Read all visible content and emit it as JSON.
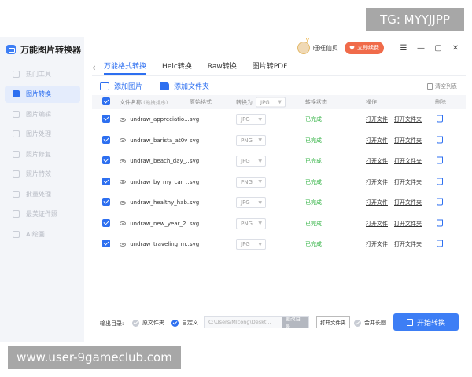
{
  "app": {
    "title": "万能图片转换器"
  },
  "sidebar": {
    "items": [
      {
        "label": "热门工具",
        "active": false
      },
      {
        "label": "图片转换",
        "active": true
      },
      {
        "label": "图片编辑",
        "active": false
      },
      {
        "label": "图片处理",
        "active": false
      },
      {
        "label": "照片修复",
        "active": false
      },
      {
        "label": "照片特效",
        "active": false
      },
      {
        "label": "批量处理",
        "active": false
      },
      {
        "label": "最美证件照",
        "active": false
      },
      {
        "label": "AI绘画",
        "active": false
      }
    ]
  },
  "topbar": {
    "user_name": "旺旺仙贝",
    "vip_label": "立即续费",
    "menu_icon": "menu-icon",
    "minimize": "—",
    "maximize": "▢",
    "close": "✕"
  },
  "tabs": [
    {
      "label": "万能格式转换",
      "active": true
    },
    {
      "label": "Heic转换",
      "active": false
    },
    {
      "label": "Raw转换",
      "active": false
    },
    {
      "label": "图片转PDF",
      "active": false
    }
  ],
  "toolbar": {
    "add_image": "添加图片",
    "add_folder": "添加文件夹",
    "clear_list": "清空列表"
  },
  "table": {
    "headers": {
      "file_name": "文件名称",
      "file_name_hint": "(拖拽排序)",
      "original_format": "原始格式",
      "convert_to": "转换为",
      "convert_to_value": "JPG",
      "status": "转换状态",
      "actions": "操作",
      "delete": "删除"
    },
    "rows": [
      {
        "name": "undraw_appreciatio...",
        "format": "svg",
        "target": "JPG",
        "status": "已完成",
        "open_file": "打开文件",
        "open_folder": "打开文件夹"
      },
      {
        "name": "undraw_barista_at0v",
        "format": "svg",
        "target": "PNG",
        "status": "已完成",
        "open_file": "打开文件",
        "open_folder": "打开文件夹"
      },
      {
        "name": "undraw_beach_day_...",
        "format": "svg",
        "target": "JPG",
        "status": "已完成",
        "open_file": "打开文件",
        "open_folder": "打开文件夹"
      },
      {
        "name": "undraw_by_my_car_...",
        "format": "svg",
        "target": "PNG",
        "status": "已完成",
        "open_file": "打开文件",
        "open_folder": "打开文件夹"
      },
      {
        "name": "undraw_healthy_hab...",
        "format": "svg",
        "target": "JPG",
        "status": "已完成",
        "open_file": "打开文件",
        "open_folder": "打开文件夹"
      },
      {
        "name": "undraw_new_year_2...",
        "format": "svg",
        "target": "PNG",
        "status": "已完成",
        "open_file": "打开文件",
        "open_folder": "打开文件夹"
      },
      {
        "name": "undraw_traveling_m...",
        "format": "svg",
        "target": "JPG",
        "status": "已完成",
        "open_file": "打开文件",
        "open_folder": "打开文件夹"
      }
    ]
  },
  "bottom": {
    "output_label": "输出目录:",
    "opt_original": "原文件夹",
    "opt_custom": "自定义",
    "path": "C:\\Users\\Mlcong\\Deskt...",
    "change_dir": "更改目录",
    "open_folder": "打开文件夹",
    "merge_long": "合并长图",
    "start": "开始转换"
  },
  "overlays": {
    "tg": "TG: MYYJJPP",
    "watermark": "www.user-9gameclub.com"
  },
  "colors": {
    "accent": "#2d6ff0",
    "done": "#39b54a",
    "vip": "#f06b4a"
  }
}
